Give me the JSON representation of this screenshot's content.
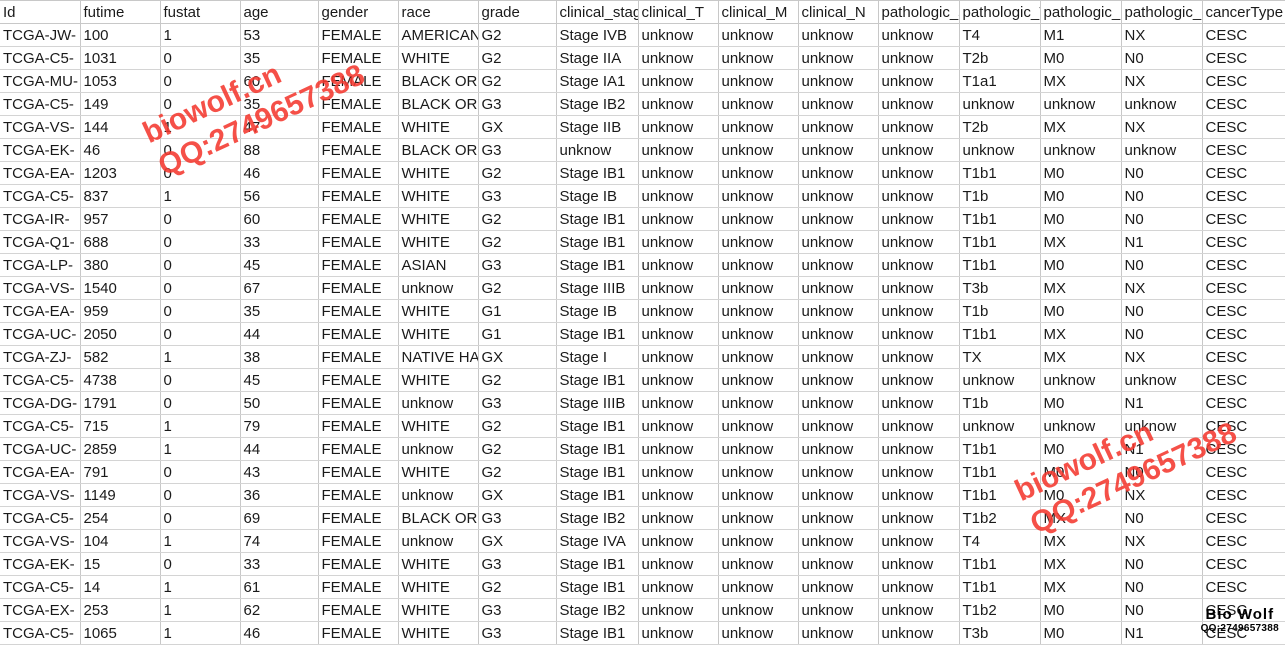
{
  "sheet": {
    "columns": [
      {
        "key": "id",
        "header": "Id",
        "align": "txt"
      },
      {
        "key": "futime",
        "header": "futime",
        "align": "num"
      },
      {
        "key": "fustat",
        "header": "fustat",
        "align": "num"
      },
      {
        "key": "age",
        "header": "age",
        "align": "num"
      },
      {
        "key": "gender",
        "header": "gender",
        "align": "txt"
      },
      {
        "key": "race",
        "header": "race",
        "align": "txt"
      },
      {
        "key": "grade",
        "header": "grade",
        "align": "txt"
      },
      {
        "key": "cstage",
        "header": "clinical_stage",
        "align": "txt"
      },
      {
        "key": "ct",
        "header": "clinical_T",
        "align": "txt"
      },
      {
        "key": "cm",
        "header": "clinical_M",
        "align": "txt"
      },
      {
        "key": "cn",
        "header": "clinical_N",
        "align": "txt"
      },
      {
        "key": "pstage",
        "header": "pathologic_stage",
        "align": "txt"
      },
      {
        "key": "pt",
        "header": "pathologic_T",
        "align": "txt"
      },
      {
        "key": "pm",
        "header": "pathologic_M",
        "align": "txt"
      },
      {
        "key": "pn",
        "header": "pathologic_N",
        "align": "txt"
      },
      {
        "key": "cancer",
        "header": "cancerType",
        "align": "txt"
      }
    ],
    "rows": [
      [
        "TCGA-JW-",
        "100",
        "1",
        "53",
        "FEMALE",
        "AMERICAN INDIAN OR ALASKA NATIVE",
        "G2",
        "Stage IVB",
        "unknow",
        "unknow",
        "unknow",
        "unknow",
        "T4",
        "M1",
        "NX",
        "CESC"
      ],
      [
        "TCGA-C5-",
        "1031",
        "0",
        "35",
        "FEMALE",
        "WHITE",
        "G2",
        "Stage IIA",
        "unknow",
        "unknow",
        "unknow",
        "unknow",
        "T2b",
        "M0",
        "N0",
        "CESC"
      ],
      [
        "TCGA-MU-",
        "1053",
        "0",
        "60",
        "FEMALE",
        "BLACK OR AFRICAN AMERICAN",
        "G2",
        "Stage IA1",
        "unknow",
        "unknow",
        "unknow",
        "unknow",
        "T1a1",
        "MX",
        "NX",
        "CESC"
      ],
      [
        "TCGA-C5-",
        "149",
        "0",
        "35",
        "FEMALE",
        "BLACK OR AFRICAN AMERICAN",
        "G3",
        "Stage IB2",
        "unknow",
        "unknow",
        "unknow",
        "unknow",
        "unknow",
        "unknow",
        "unknow",
        "CESC"
      ],
      [
        "TCGA-VS-",
        "144",
        "1",
        "47",
        "FEMALE",
        "WHITE",
        "GX",
        "Stage IIB",
        "unknow",
        "unknow",
        "unknow",
        "unknow",
        "T2b",
        "MX",
        "NX",
        "CESC"
      ],
      [
        "TCGA-EK-",
        "46",
        "0",
        "88",
        "FEMALE",
        "BLACK OR AFRICAN AMERICAN",
        "G3",
        "unknow",
        "unknow",
        "unknow",
        "unknow",
        "unknow",
        "unknow",
        "unknow",
        "unknow",
        "CESC"
      ],
      [
        "TCGA-EA-",
        "1203",
        "0",
        "46",
        "FEMALE",
        "WHITE",
        "G2",
        "Stage IB1",
        "unknow",
        "unknow",
        "unknow",
        "unknow",
        "T1b1",
        "M0",
        "N0",
        "CESC"
      ],
      [
        "TCGA-C5-",
        "837",
        "1",
        "56",
        "FEMALE",
        "WHITE",
        "G3",
        "Stage IB",
        "unknow",
        "unknow",
        "unknow",
        "unknow",
        "T1b",
        "M0",
        "N0",
        "CESC"
      ],
      [
        "TCGA-IR-",
        "957",
        "0",
        "60",
        "FEMALE",
        "WHITE",
        "G2",
        "Stage IB1",
        "unknow",
        "unknow",
        "unknow",
        "unknow",
        "T1b1",
        "M0",
        "N0",
        "CESC"
      ],
      [
        "TCGA-Q1-",
        "688",
        "0",
        "33",
        "FEMALE",
        "WHITE",
        "G2",
        "Stage IB1",
        "unknow",
        "unknow",
        "unknow",
        "unknow",
        "T1b1",
        "MX",
        "N1",
        "CESC"
      ],
      [
        "TCGA-LP-",
        "380",
        "0",
        "45",
        "FEMALE",
        "ASIAN",
        "G3",
        "Stage IB1",
        "unknow",
        "unknow",
        "unknow",
        "unknow",
        "T1b1",
        "M0",
        "N0",
        "CESC"
      ],
      [
        "TCGA-VS-",
        "1540",
        "0",
        "67",
        "FEMALE",
        "unknow",
        "G2",
        "Stage IIIB",
        "unknow",
        "unknow",
        "unknow",
        "unknow",
        "T3b",
        "MX",
        "NX",
        "CESC"
      ],
      [
        "TCGA-EA-",
        "959",
        "0",
        "35",
        "FEMALE",
        "WHITE",
        "G1",
        "Stage IB",
        "unknow",
        "unknow",
        "unknow",
        "unknow",
        "T1b",
        "M0",
        "N0",
        "CESC"
      ],
      [
        "TCGA-UC-",
        "2050",
        "0",
        "44",
        "FEMALE",
        "WHITE",
        "G1",
        "Stage IB1",
        "unknow",
        "unknow",
        "unknow",
        "unknow",
        "T1b1",
        "MX",
        "N0",
        "CESC"
      ],
      [
        "TCGA-ZJ-",
        "582",
        "1",
        "38",
        "FEMALE",
        "NATIVE HAWAIIAN OR OTHER PACIFIC ISLANDER",
        "GX",
        "Stage I",
        "unknow",
        "unknow",
        "unknow",
        "unknow",
        "TX",
        "MX",
        "NX",
        "CESC"
      ],
      [
        "TCGA-C5-",
        "4738",
        "0",
        "45",
        "FEMALE",
        "WHITE",
        "G2",
        "Stage IB1",
        "unknow",
        "unknow",
        "unknow",
        "unknow",
        "unknow",
        "unknow",
        "unknow",
        "CESC"
      ],
      [
        "TCGA-DG-",
        "1791",
        "0",
        "50",
        "FEMALE",
        "unknow",
        "G3",
        "Stage IIIB",
        "unknow",
        "unknow",
        "unknow",
        "unknow",
        "T1b",
        "M0",
        "N1",
        "CESC"
      ],
      [
        "TCGA-C5-",
        "715",
        "1",
        "79",
        "FEMALE",
        "WHITE",
        "G2",
        "Stage IB1",
        "unknow",
        "unknow",
        "unknow",
        "unknow",
        "unknow",
        "unknow",
        "unknow",
        "CESC"
      ],
      [
        "TCGA-UC-",
        "2859",
        "1",
        "44",
        "FEMALE",
        "unknow",
        "G2",
        "Stage IB1",
        "unknow",
        "unknow",
        "unknow",
        "unknow",
        "T1b1",
        "M0",
        "N1",
        "CESC"
      ],
      [
        "TCGA-EA-",
        "791",
        "0",
        "43",
        "FEMALE",
        "WHITE",
        "G2",
        "Stage IB1",
        "unknow",
        "unknow",
        "unknow",
        "unknow",
        "T1b1",
        "M0",
        "N0",
        "CESC"
      ],
      [
        "TCGA-VS-",
        "1149",
        "0",
        "36",
        "FEMALE",
        "unknow",
        "GX",
        "Stage IB1",
        "unknow",
        "unknow",
        "unknow",
        "unknow",
        "T1b1",
        "M0",
        "NX",
        "CESC"
      ],
      [
        "TCGA-C5-",
        "254",
        "0",
        "69",
        "FEMALE",
        "BLACK OR AFRICAN AMERICAN",
        "G3",
        "Stage IB2",
        "unknow",
        "unknow",
        "unknow",
        "unknow",
        "T1b2",
        "MX",
        "N0",
        "CESC"
      ],
      [
        "TCGA-VS-",
        "104",
        "1",
        "74",
        "FEMALE",
        "unknow",
        "GX",
        "Stage IVA",
        "unknow",
        "unknow",
        "unknow",
        "unknow",
        "T4",
        "MX",
        "NX",
        "CESC"
      ],
      [
        "TCGA-EK-",
        "15",
        "0",
        "33",
        "FEMALE",
        "WHITE",
        "G3",
        "Stage IB1",
        "unknow",
        "unknow",
        "unknow",
        "unknow",
        "T1b1",
        "MX",
        "N0",
        "CESC"
      ],
      [
        "TCGA-C5-",
        "14",
        "1",
        "61",
        "FEMALE",
        "WHITE",
        "G2",
        "Stage IB1",
        "unknow",
        "unknow",
        "unknow",
        "unknow",
        "T1b1",
        "MX",
        "N0",
        "CESC"
      ],
      [
        "TCGA-EX-",
        "253",
        "1",
        "62",
        "FEMALE",
        "WHITE",
        "G3",
        "Stage IB2",
        "unknow",
        "unknow",
        "unknow",
        "unknow",
        "T1b2",
        "M0",
        "N0",
        "CESC"
      ],
      [
        "TCGA-C5-",
        "1065",
        "1",
        "46",
        "FEMALE",
        "WHITE",
        "G3",
        "Stage IB1",
        "unknow",
        "unknow",
        "unknow",
        "unknow",
        "T3b",
        "M0",
        "N1",
        "CESC"
      ]
    ]
  },
  "watermarks": {
    "primary": {
      "line1": "biowolf.cn",
      "line2": "QQ:2749657388"
    },
    "secondary": {
      "line1": "biowolf.cn",
      "line2": "QQ:2749657388"
    },
    "logo": {
      "brand": "Bio Wolf",
      "qq": "QQ:2749657388"
    }
  },
  "colors": {
    "watermark": "#f4392f",
    "grid_line": "#c8c8c8",
    "text": "#1a1a1a"
  }
}
